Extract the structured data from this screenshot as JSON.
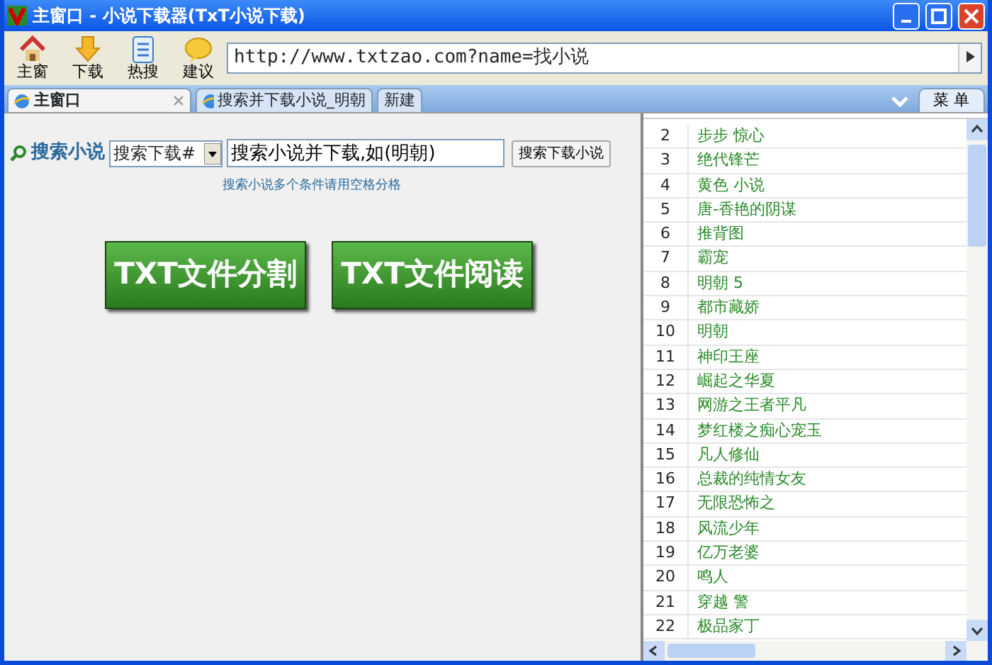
{
  "window": {
    "title": "主窗口 - 小说下载器(TxT小说下载)"
  },
  "toolbar": [
    {
      "label": "主窗",
      "kind": "home"
    },
    {
      "label": "下载",
      "kind": "download"
    },
    {
      "label": "热搜",
      "kind": "list"
    },
    {
      "label": "建议",
      "kind": "chat"
    }
  ],
  "address_bar": {
    "value": "http://www.txtzao.com?name=找小说"
  },
  "tabs": [
    {
      "label": "主窗口",
      "selected": true,
      "closable": true
    },
    {
      "label": "搜索并下载小说_明朝",
      "selected": false,
      "closable": false
    },
    {
      "label": "新建",
      "selected": false,
      "closable": false
    }
  ],
  "menu_button": "菜 单",
  "search": {
    "label": "搜索小说",
    "dropdown": "搜索下载#",
    "value": "搜索小说并下载,如(明朝)",
    "button": "搜索下载小说",
    "hint": "搜索小说多个条件请用空格分格"
  },
  "action_buttons": [
    "TXT文件分割",
    "TXT文件阅读"
  ],
  "list": {
    "rows": [
      {
        "number": "2",
        "title": "步步 惊心"
      },
      {
        "number": "3",
        "title": "绝代锋芒"
      },
      {
        "number": "4",
        "title": "黄色 小说"
      },
      {
        "number": "5",
        "title": "唐-香艳的阴谋"
      },
      {
        "number": "6",
        "title": "推背图"
      },
      {
        "number": "7",
        "title": "霸宠"
      },
      {
        "number": "8",
        "title": "明朝 5"
      },
      {
        "number": "9",
        "title": "都市藏娇"
      },
      {
        "number": "10",
        "title": "明朝"
      },
      {
        "number": "11",
        "title": "神印王座"
      },
      {
        "number": "12",
        "title": "崛起之华夏"
      },
      {
        "number": "13",
        "title": "网游之王者平凡"
      },
      {
        "number": "14",
        "title": "梦红楼之痴心宠玉"
      },
      {
        "number": "15",
        "title": "凡人修仙"
      },
      {
        "number": "16",
        "title": "总裁的纯情女友"
      },
      {
        "number": "17",
        "title": "无限恐怖之"
      },
      {
        "number": "18",
        "title": "风流少年"
      },
      {
        "number": "19",
        "title": "亿万老婆"
      },
      {
        "number": "20",
        "title": "鸣人"
      },
      {
        "number": "21",
        "title": "穿越 警"
      },
      {
        "number": "22",
        "title": "极品家丁"
      }
    ]
  }
}
